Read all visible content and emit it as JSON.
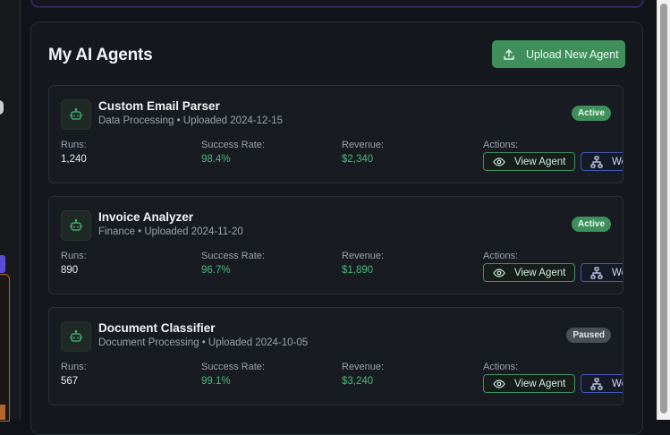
{
  "panel": {
    "title": "My AI Agents",
    "upload_button": "Upload New Agent"
  },
  "agents": [
    {
      "name": "Custom Email Parser",
      "meta": "Data Processing • Uploaded 2024-12-15",
      "status": "Active",
      "runs_label": "Runs:",
      "runs": "1,240",
      "success_label": "Success Rate:",
      "success": "98.4%",
      "revenue_label": "Revenue:",
      "revenue": "$2,340",
      "actions_label": "Actions:",
      "view_label": "View Agent",
      "workflow_label": "Workflow"
    },
    {
      "name": "Invoice Analyzer",
      "meta": "Finance • Uploaded 2024-11-20",
      "status": "Active",
      "runs_label": "Runs:",
      "runs": "890",
      "success_label": "Success Rate:",
      "success": "96.7%",
      "revenue_label": "Revenue:",
      "revenue": "$1,890",
      "actions_label": "Actions:",
      "view_label": "View Agent",
      "workflow_label": "Workflow"
    },
    {
      "name": "Document Classifier",
      "meta": "Document Processing • Uploaded 2024-10-05",
      "status": "Paused",
      "runs_label": "Runs:",
      "runs": "567",
      "success_label": "Success Rate:",
      "success": "99.1%",
      "revenue_label": "Revenue:",
      "revenue": "$3,240",
      "actions_label": "Actions:",
      "view_label": "View Agent",
      "workflow_label": "Workflow"
    }
  ],
  "icons": {
    "upload": "upload-icon",
    "bot": "bot-icon",
    "eye": "eye-icon",
    "workflow": "workflow-icon"
  },
  "colors": {
    "accent_green": "#3f8f5d",
    "success_text": "#48b877",
    "workflow_blue": "#4257b4",
    "paused_badge": "#4b5058"
  }
}
